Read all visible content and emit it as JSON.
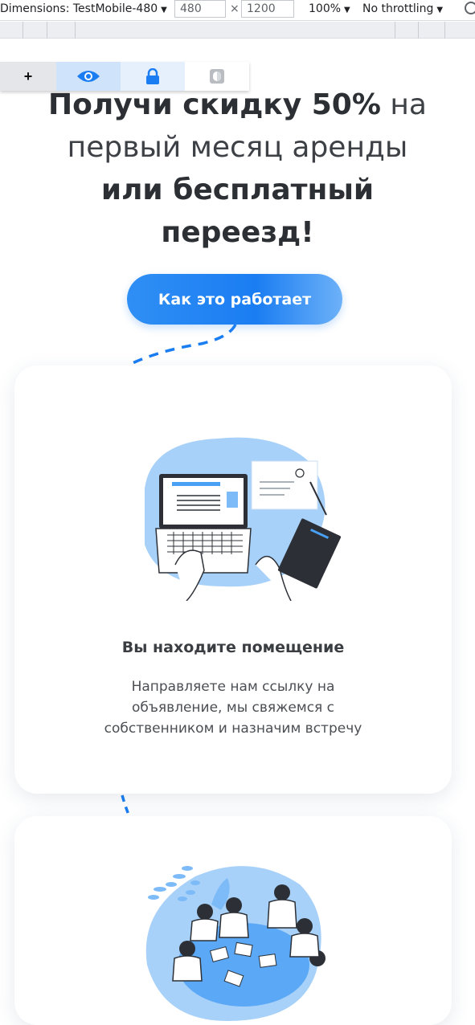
{
  "devtools": {
    "dimensions_label": "Dimensions: TestMobile-480",
    "width_value": "480",
    "height_value": "1200",
    "times_sign": "×",
    "zoom_label": "100%",
    "throttle_label": "No throttling",
    "dropdown_arrow": "▼"
  },
  "toolbar": {
    "add_label": "+",
    "eye_icon": "eye-icon",
    "lock_icon": "lock-icon",
    "contrast_icon": "contrast-icon"
  },
  "hero": {
    "line1_bold": "Получи скидку 50%",
    "line1_light": " на",
    "line2_light": "первый месяц аренды",
    "line3_bold": "или бесплатный",
    "line4_bold": "переезд!",
    "cta_label": "Как это работает"
  },
  "steps": [
    {
      "title": "Вы находите помещение",
      "text": "Направляете нам ссылку на объявление, мы свяжемся с собственником и назначим встречу"
    }
  ],
  "colors": {
    "accent": "#1a7df2",
    "blob": "#9ccbf8",
    "heading": "#2c2f33"
  }
}
